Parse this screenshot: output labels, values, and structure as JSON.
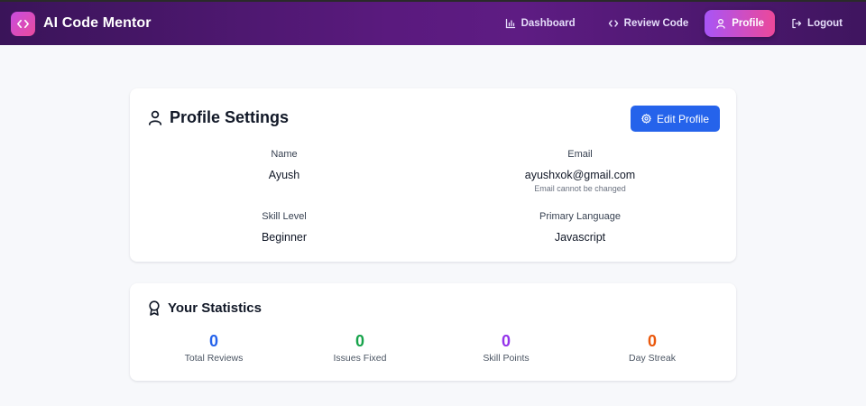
{
  "app": {
    "title": "AI Code Mentor"
  },
  "nav": {
    "items": [
      {
        "label": "Dashboard",
        "icon": "bar-chart-icon"
      },
      {
        "label": "Review Code",
        "icon": "code-icon"
      },
      {
        "label": "Profile",
        "icon": "user-icon",
        "active": true
      },
      {
        "label": "Logout",
        "icon": "logout-icon"
      }
    ]
  },
  "profile": {
    "title": "Profile Settings",
    "edit_label": "Edit Profile",
    "fields": {
      "name": {
        "label": "Name",
        "value": "Ayush"
      },
      "email": {
        "label": "Email",
        "value": "ayushxok@gmail.com",
        "hint": "Email cannot be changed"
      },
      "skill": {
        "label": "Skill Level",
        "value": "Beginner"
      },
      "language": {
        "label": "Primary Language",
        "value": "Javascript"
      }
    }
  },
  "stats": {
    "title": "Your Statistics",
    "items": [
      {
        "value": "0",
        "label": "Total Reviews",
        "color": "#2563eb"
      },
      {
        "value": "0",
        "label": "Issues Fixed",
        "color": "#16a34a"
      },
      {
        "value": "0",
        "label": "Skill Points",
        "color": "#9333ea"
      },
      {
        "value": "0",
        "label": "Day Streak",
        "color": "#ea580c"
      }
    ]
  },
  "colors": {
    "navbar_start": "#3a1459",
    "navbar_mid": "#5e1c83",
    "accent_blue": "#2563eb",
    "active_gradient_start": "#a855f7",
    "active_gradient_end": "#ec4899"
  }
}
